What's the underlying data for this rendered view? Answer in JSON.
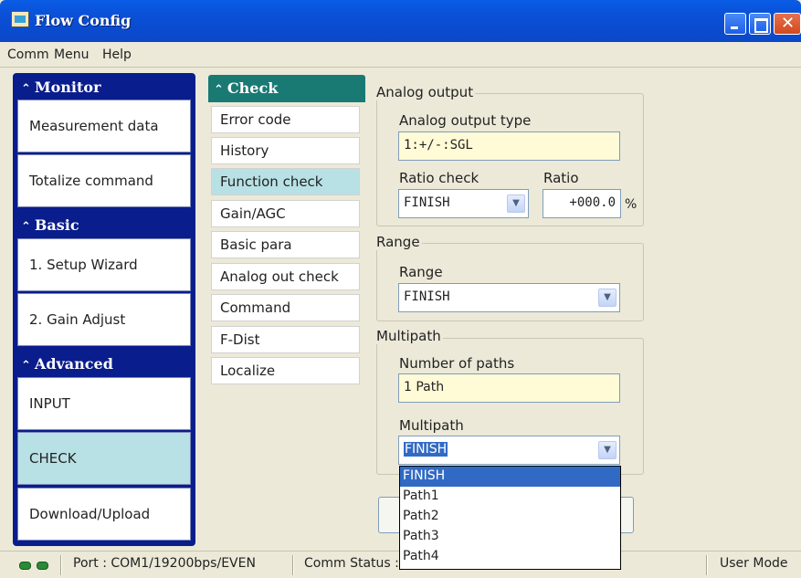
{
  "window": {
    "title": "Flow Config"
  },
  "menu": [
    "Comm",
    "Menu",
    "Help"
  ],
  "left_nav": {
    "monitor": {
      "header": "Monitor",
      "items": [
        "Measurement data",
        "Totalize command"
      ]
    },
    "basic": {
      "header": "Basic",
      "items": [
        "1. Setup Wizard",
        "2. Gain Adjust"
      ]
    },
    "advanced": {
      "header": "Advanced",
      "items": [
        "INPUT",
        "CHECK",
        "Download/Upload"
      ],
      "selected": "CHECK"
    }
  },
  "check_nav": {
    "header": "Check",
    "items": [
      "Error code",
      "History",
      "Function check",
      "Gain/AGC",
      "Basic para",
      "Analog out check",
      "Command",
      "F-Dist",
      "Localize"
    ],
    "selected": "Function check"
  },
  "analog_output": {
    "group_title": "Analog output",
    "type_label": "Analog output type",
    "type_value": "1:+/-:SGL",
    "ratio_check_label": "Ratio check",
    "ratio_check_value": "FINISH",
    "ratio_label": "Ratio",
    "ratio_value": "+000.0",
    "ratio_unit": "%"
  },
  "range": {
    "group_title": "Range",
    "range_label": "Range",
    "range_value": "FINISH"
  },
  "multipath": {
    "group_title": "Multipath",
    "paths_label": "Number of paths",
    "paths_value": "1 Path",
    "multipath_label": "Multipath",
    "multipath_value": "FINISH",
    "options": [
      "FINISH",
      "Path1",
      "Path2",
      "Path3",
      "Path4"
    ],
    "highlighted_option": "FINISH"
  },
  "status_bar": {
    "port": "Port : COM1/19200bps/EVEN",
    "comm_status": "Comm Status : OK",
    "mode": "User Mode"
  },
  "colors": {
    "nav_bg": "#0a1d8c",
    "check_header": "#197a74",
    "selected_item": "#b8e1e6",
    "readonly_field": "#fffbd6",
    "selection_blue": "#316ac5"
  }
}
